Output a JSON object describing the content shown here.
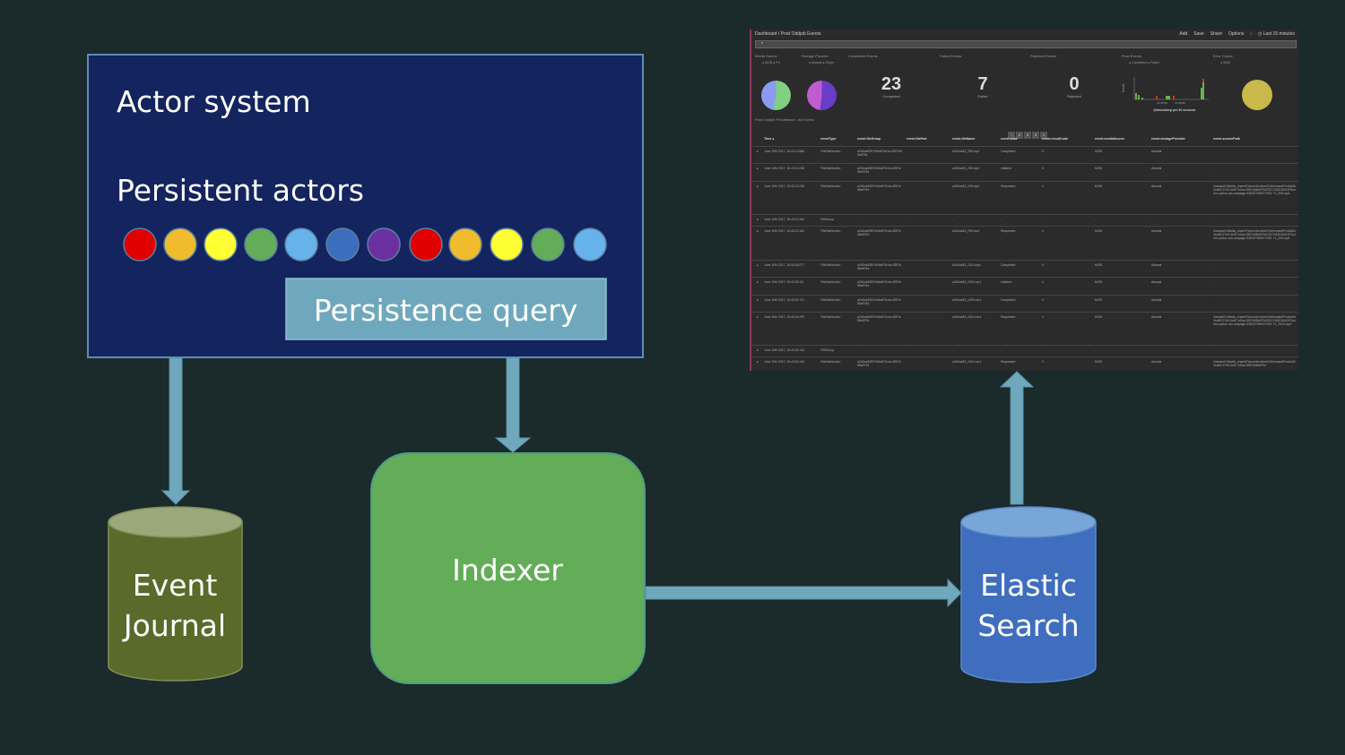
{
  "diagram": {
    "actor_system": {
      "title": "Actor system",
      "subtitle": "Persistent actors",
      "fill": "#13245e",
      "border": "#5b8fb8"
    },
    "actors": [
      {
        "color": "#e00000"
      },
      {
        "color": "#f0bc2e"
      },
      {
        "color": "#ffff33"
      },
      {
        "color": "#63ad58"
      },
      {
        "color": "#66b3ec"
      },
      {
        "color": "#3c6ebf"
      },
      {
        "color": "#6a30a0"
      },
      {
        "color": "#e00000"
      },
      {
        "color": "#f0bc2e"
      },
      {
        "color": "#ffff33"
      },
      {
        "color": "#63ad58"
      },
      {
        "color": "#66b3ec"
      }
    ],
    "persistence_query": {
      "label": "Persistence query",
      "fill": "#6fa8bd"
    },
    "event_journal": {
      "line1": "Event",
      "line2": "Journal",
      "fill": "#5a6a2a",
      "top": "#9aa87a"
    },
    "indexer": {
      "label": "Indexer",
      "fill": "#63ad58"
    },
    "elastic_search": {
      "line1": "Elastic",
      "line2": "Search",
      "fill": "#3f6ebf",
      "top": "#79a6d8"
    },
    "arrow_color": "#6fa8bd",
    "edges": [
      {
        "from": "actor_system",
        "to": "event_journal"
      },
      {
        "from": "persistence_query",
        "to": "indexer"
      },
      {
        "from": "indexer",
        "to": "elastic_search"
      },
      {
        "from": "elastic_search",
        "to": "dashboard"
      }
    ]
  },
  "dashboard": {
    "breadcrumb": "Dashboard / Prod Oddjob Events",
    "menu": [
      "Add",
      "Save",
      "Share",
      "Options",
      "‹",
      "◷ Last 15 minutes"
    ],
    "search_value": "*",
    "panels": {
      "media_source": {
        "title": "Media Source",
        "legend": "● MOB ● PS"
      },
      "storage_provider": {
        "title": "Storage Provider",
        "legend": "● Akamai ● Origin"
      },
      "completed": {
        "title": "Completed Events",
        "value": "23",
        "label": "Completed"
      },
      "failed": {
        "title": "Failed Events",
        "value": "7",
        "label": "Failed"
      },
      "rejected": {
        "title": "Rejected Events",
        "value": "0",
        "label": "Rejected"
      },
      "final": {
        "title": "Final Events",
        "legend": "● Completed ● Failed",
        "ylabel": "Count",
        "ticks": [
          "15:35:00",
          "15:40:00"
        ],
        "xlabel": "@timestamp per 30 seconds"
      },
      "error_codes": {
        "title": "Error Codes",
        "legend": "● 5000"
      }
    },
    "table_title": "Prod Oddjob Persistence - All Events",
    "pages": [
      "‹",
      "2",
      "3",
      "4",
      "»"
    ],
    "columns": [
      "Time ▴",
      "eventType",
      "event.fileGroup",
      "event.filePart",
      "event.fileName",
      "event.state",
      "event.resultCode",
      "event.mediaSource",
      "event.storageProvider",
      "event.sourcePath"
    ],
    "rows": [
      [
        "June 10th 2017, 15:43:13.566",
        "FileDistribution",
        "a2b1ba8397e54e87b1ba 8397e58e879d",
        "",
        "a2b1ba83_205.mp4",
        "Completed",
        "0",
        "MOB",
        "Akamai",
        "-"
      ],
      [
        "June 10th 2017, 15:43:13.238",
        "FileDistribution",
        "a2b1ba83f97e54e87b1ba 8397e58e879d",
        "",
        "a2b1ba83_205.mp4",
        "Initiated",
        "0",
        "MOB",
        "Akamai",
        "-"
      ],
      [
        "June 10th 2017, 15:43:13.238",
        "FileDistribution",
        "a2b1ba83f97e54e87b1ba 8397e58e879d",
        "",
        "a2b1ba83_205.mp4",
        "Requested",
        "0",
        "MOB",
        "Akamai",
        "\\\\nanas01\\Media_share\\Poison\\Archive\\OnDemand\\Prod\\a2b1ba83-97e5-4e87-b1ba-8397e58e879d\\20170610154157\\london-police-ran-rampage-636327060671901 71_205.mp4"
      ],
      [
        "June 10th 2017, 15:43:13.160",
        "FileGroup",
        "-",
        "-",
        "-",
        "-",
        "-",
        "-",
        "-",
        "-"
      ],
      [
        "June 10th 2017, 15:43:13.160",
        "FileDistribution",
        "a2b1ba83f97e54e87b1ba 8397e58e879d",
        "",
        "a2b1ba83_205.mp4",
        "Requested",
        "0",
        "MOB",
        "Akamai",
        "\\\\nanas01\\Media_share\\Poison\\Archive\\OnDemand\\Prod\\a2b1ba83-97e5-4e87-b1ba-8397e58e879d\\20170610154157\\london-police-ran-rampage-636327060671901 71_205.mp4"
      ],
      [
        "June 10th 2017, 15:43:06.077",
        "FileDistribution",
        "a2b1ba83f97e54e87b1ba 8397e58e879d",
        "",
        "a2b1ba83_2410.mp4",
        "Completed",
        "0",
        "MOB",
        "Akamai",
        "-"
      ],
      [
        "June 10th 2017, 15:43:05.111",
        "FileDistribution",
        "a2b1ba83f97e54e87b1ba 8397e58e879d",
        "",
        "a2b1ba83_2410.mp4",
        "Initiated",
        "0",
        "MOB",
        "Akamai",
        "-"
      ],
      [
        "June 10th 2017, 15:43:04.721",
        "FileDistribution",
        "a2b1ba83f97e54e87b1ba 8397e58e879d",
        "",
        "a2b1ba83_1394.mp4",
        "Completed",
        "0",
        "MOB",
        "Akamai",
        "-"
      ],
      [
        "June 10th 2017, 15:43:04.299",
        "FileDistribution",
        "a2b1ba83f97e54e87b1ba 8397e58e879d",
        "",
        "a2b1ba83_2410.mp4",
        "Requested",
        "0",
        "MOB",
        "Akamai",
        "\\\\nanas01\\Media_share\\Poison\\Archive\\OnDemand\\Prod\\a2b1ba83-97e5-4e87-b1ba-8397e58e879d\\20170610154157\\london-police-ran-rampage-636327060671901 71_2410.mp4"
      ],
      [
        "June 10th 2017, 15:43:04.143",
        "FileGroup",
        "-",
        "-",
        "-",
        "-",
        "-",
        "-",
        "-",
        "-"
      ],
      [
        "June 10th 2017, 15:43:04.143",
        "FileDistribution",
        "a2b1ba83f97e54e87b1ba 8397e58e879d",
        "",
        "a2b1ba83_2410.mp4",
        "Requested",
        "0",
        "MOB",
        "Akamai",
        "\\\\nanas01\\Media_share\\Poison\\Archive\\OnDemand\\Prod\\a2b1ba83-97e5-4e87-b1ba-8397e58e879d"
      ]
    ]
  }
}
